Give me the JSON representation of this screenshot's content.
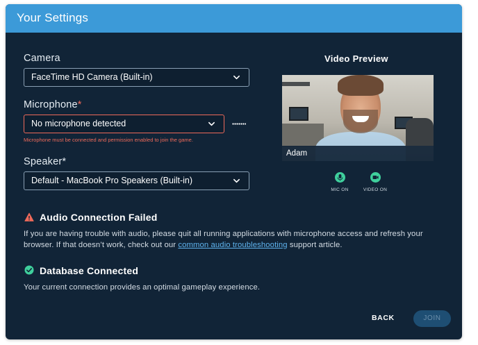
{
  "dialog": {
    "title": "Your Settings"
  },
  "camera": {
    "label": "Camera",
    "selected": "FaceTime HD Camera (Built-in)"
  },
  "microphone": {
    "label": "Microphone",
    "required_mark": "*",
    "selected": "No microphone detected",
    "hint": "Microphone must be connected and permission enabled to join the game."
  },
  "speaker": {
    "label": "Speaker",
    "required_mark": "*",
    "selected": "Default - MacBook Pro Speakers (Built-in)"
  },
  "preview": {
    "title": "Video Preview",
    "name": "Adam",
    "mic_label": "MIC ON",
    "video_label": "VIDEO ON",
    "mic_icon": "microphone-icon",
    "video_icon": "video-camera-icon"
  },
  "audio_alert": {
    "icon": "warning-icon",
    "title": "Audio Connection Failed",
    "text_before": "If you are having trouble with audio, please quit all running applications with microphone access and refresh your browser. If that doesn’t work, check out our ",
    "link": "common audio troubleshooting",
    "text_after": " support article."
  },
  "db_alert": {
    "icon": "check-circle-icon",
    "title": "Database Connected",
    "text": "Your current connection provides an optimal gameplay experience."
  },
  "actions": {
    "back": "BACK",
    "join": "JOIN"
  },
  "colors": {
    "dialog_bg": "#112437",
    "titlebar": "#3c9ad8",
    "error": "#ef6a5a",
    "success": "#3fcf9c",
    "link": "#5fb3ee",
    "join_disabled_bg": "#1e4e73"
  }
}
